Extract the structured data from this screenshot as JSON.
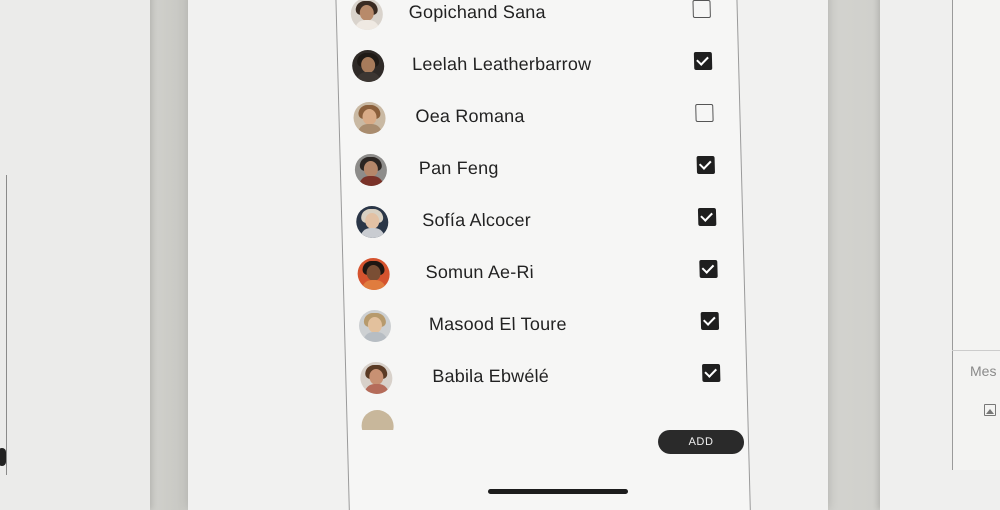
{
  "contacts": [
    {
      "name": "Gopichand Sana",
      "checked": false
    },
    {
      "name": "Leelah Leatherbarrow",
      "checked": true
    },
    {
      "name": "Oea Romana",
      "checked": false
    },
    {
      "name": "Pan Feng",
      "checked": true
    },
    {
      "name": "Sofía Alcocer",
      "checked": true
    },
    {
      "name": "Somun Ae-Ri",
      "checked": true
    },
    {
      "name": "Masood El Toure",
      "checked": true
    },
    {
      "name": "Babila Ebwélé",
      "checked": true
    }
  ],
  "add_button": {
    "label": "ADD"
  },
  "right_panel": {
    "message_placeholder": "Mes",
    "icon": "image-icon"
  },
  "colors": {
    "checkbox_on": "#1f1f1f",
    "button_bg": "#2a2a2a",
    "text": "#222222"
  }
}
